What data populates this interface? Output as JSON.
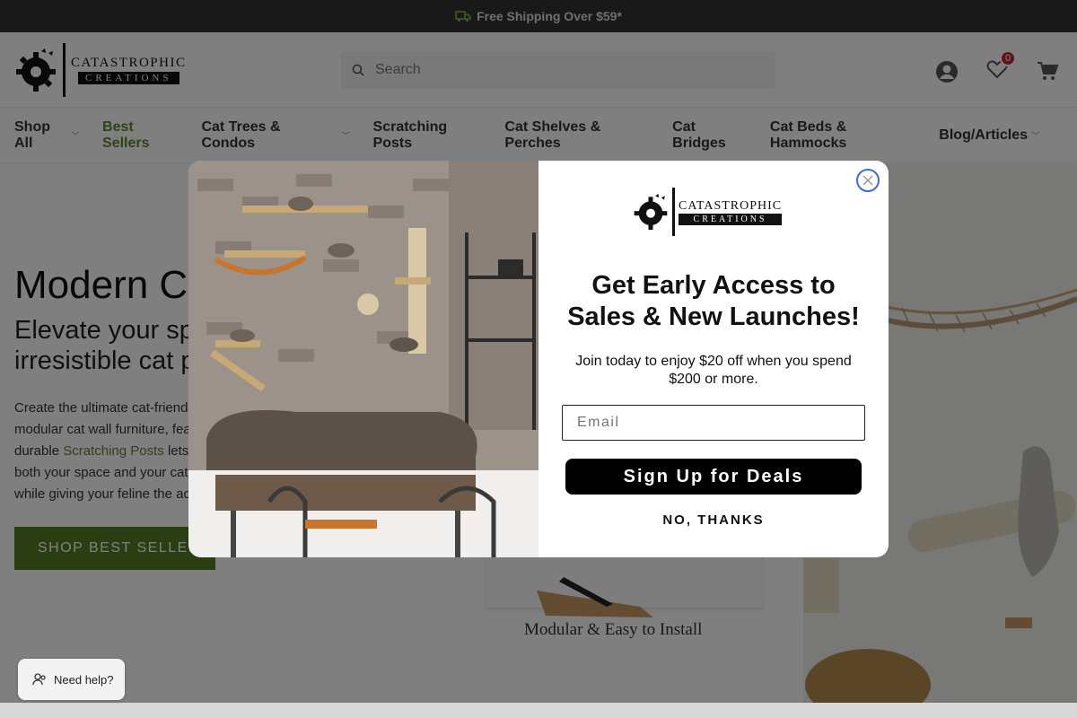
{
  "announcement": {
    "text": "Free Shipping Over $59*"
  },
  "brand": {
    "line1": "CATASTROPHIC",
    "line2": "CREATIONS"
  },
  "search": {
    "placeholder": "Search"
  },
  "header": {
    "wishlist_count": "0"
  },
  "nav": {
    "items": [
      {
        "label": "Shop All"
      },
      {
        "label": "Best Sellers"
      },
      {
        "label": "Cat Trees & Condos"
      },
      {
        "label": "Scratching Posts"
      },
      {
        "label": "Cat Shelves & Perches"
      },
      {
        "label": "Cat Bridges"
      },
      {
        "label": "Cat Beds & Hammocks"
      },
      {
        "label": "Blog/Articles"
      }
    ]
  },
  "hero": {
    "title": "Modern Ca",
    "subtitle_line1": "Elevate your spa",
    "subtitle_line2": "irresistible cat pl",
    "body_line1": "Create the ultimate cat-friend",
    "body_line2": "modular cat wall furniture, fea",
    "body_line3_pre": "durable ",
    "body_line3_link": "Scratching Posts",
    "body_line3_post": " lets",
    "body_line4": "both your space and your cat",
    "body_line5": "while giving your feline the ac",
    "cta": "SHOP BEST SELLERS",
    "install_label": "Modular & Easy to Install"
  },
  "modal": {
    "heading_line1": "Get Early Access to",
    "heading_line2": "Sales & New Launches!",
    "subtext": "Join today to enjoy $20 off when you spend $200 or more.",
    "email_placeholder": "Email",
    "signup_label": "Sign Up for Deals",
    "decline_label": "NO, THANKS"
  },
  "help": {
    "label": "Need help?"
  },
  "colors": {
    "accent_green": "#527e23",
    "nav_green": "#5a8a2a",
    "badge_red": "#c4262e",
    "close_blue": "#3a6dd8"
  }
}
